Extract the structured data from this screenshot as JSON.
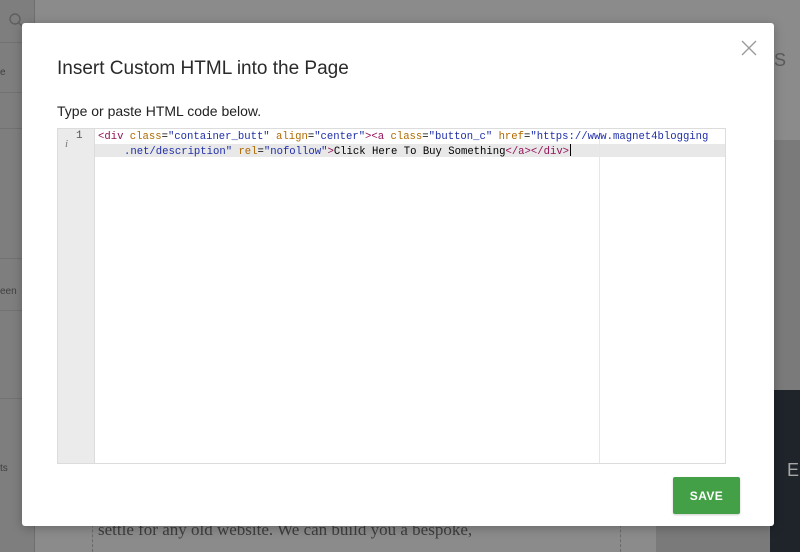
{
  "background": {
    "sidebar_labels": [
      "e",
      "een",
      "ts"
    ],
    "right_letters": [
      "S",
      "E"
    ],
    "body_text": "settle for any old website. We can build you a bespoke,"
  },
  "modal": {
    "title": "Insert Custom HTML into the Page",
    "instruction": "Type or paste HTML code below.",
    "editor": {
      "line_number": "1",
      "info_icon": "i",
      "code_tokens": {
        "tag_open": "<div",
        "attr_class": "class",
        "val_class": "\"container_butt\"",
        "attr_align": "align",
        "val_align": "\"center\"",
        "tag_a_open": "><a",
        "attr_class2": "class",
        "val_class2": "\"button_c\"",
        "attr_href": "href",
        "val_href_1": "\"https://www.magnet4blogging",
        "val_href_2": ".net/description\"",
        "attr_rel": "rel",
        "val_rel": "\"nofollow\"",
        "tag_gt": ">",
        "text": "Click Here To Buy Something",
        "tag_close": "</a></div>"
      }
    },
    "save_label": "SAVE"
  },
  "colors": {
    "save_button": "#43a047",
    "tag": "#93125a",
    "attribute": "#b06a00",
    "string": "#1f2fa8"
  }
}
